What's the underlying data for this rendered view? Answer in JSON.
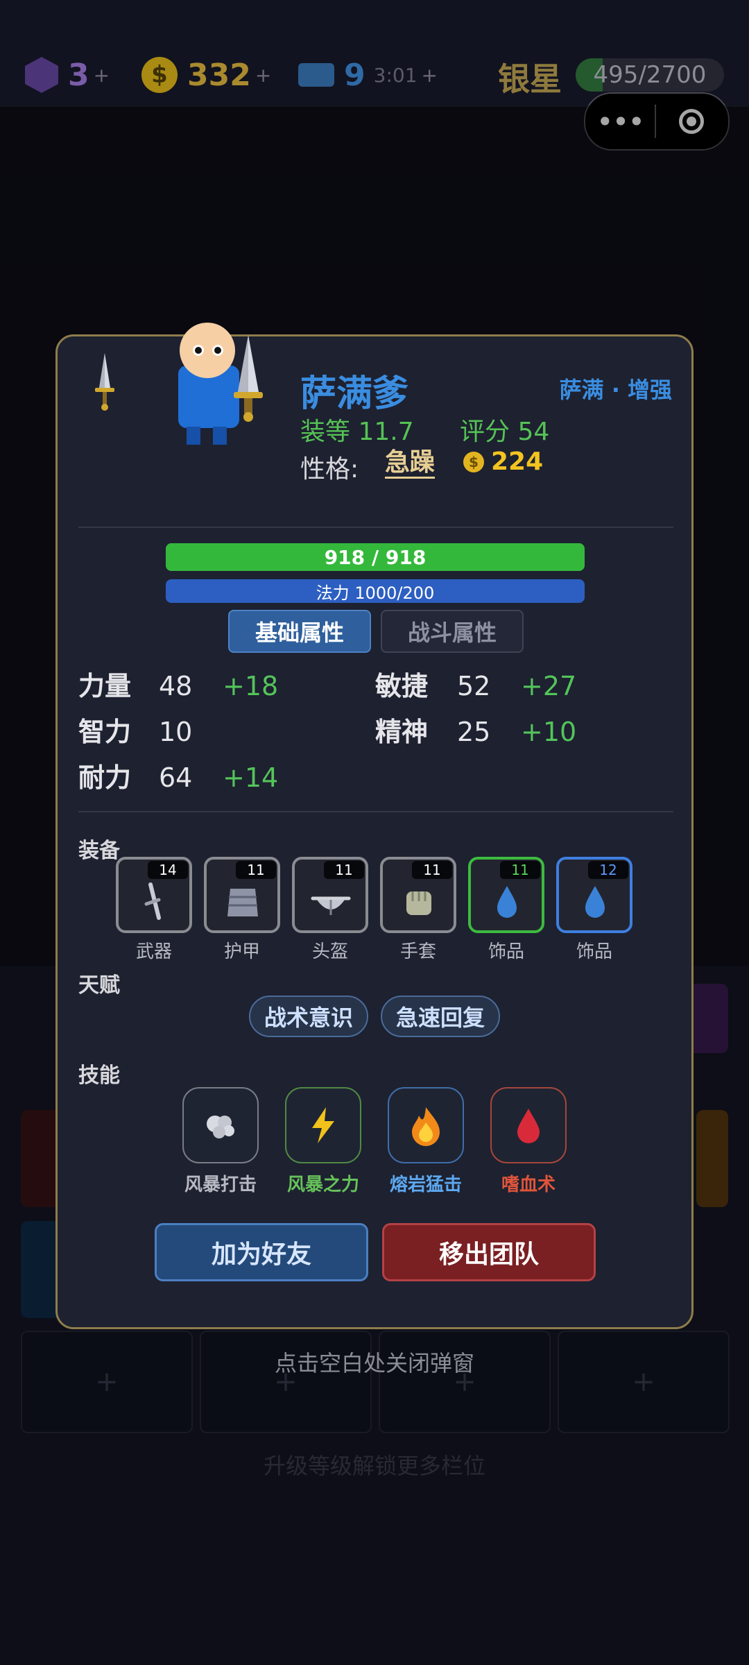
{
  "topbar": {
    "gems": "3",
    "gold": "332",
    "tickets": "9",
    "ticket_timer": "3:01",
    "plus": "+",
    "rank": "银星",
    "xp": "495/2700",
    "xp_progress": 0.183
  },
  "background": {
    "hidden_text": "升级等级解锁更多栏位",
    "slot_plus": "+"
  },
  "hero": {
    "name": "萨满爹",
    "spec": "萨满 · 增强",
    "gear_level": "装等 11.7",
    "score": "评分 54",
    "temper_label": "性格:",
    "temper": "急躁",
    "gold": "224",
    "hp_text": "918 / 918",
    "hp_progress": 1.0,
    "mp_text": "法力 1000/200",
    "mp_progress": 1.0
  },
  "tabs": {
    "basic": "基础属性",
    "combat": "战斗属性"
  },
  "stats": [
    {
      "name": "力量",
      "value": "48",
      "bonus": "+18"
    },
    {
      "name": "敏捷",
      "value": "52",
      "bonus": "+27"
    },
    {
      "name": "智力",
      "value": "10",
      "bonus": ""
    },
    {
      "name": "精神",
      "value": "25",
      "bonus": "+10"
    },
    {
      "name": "耐力",
      "value": "64",
      "bonus": "+14"
    }
  ],
  "sections": {
    "equipment": "装备",
    "talent": "天赋",
    "skills": "技能"
  },
  "equipment": [
    {
      "name": "武器",
      "level": "14",
      "icon": "sword-icon"
    },
    {
      "name": "护甲",
      "level": "11",
      "icon": "armor-icon"
    },
    {
      "name": "头盔",
      "level": "11",
      "icon": "helmet-icon"
    },
    {
      "name": "手套",
      "level": "11",
      "icon": "glove-icon"
    },
    {
      "name": "饰品",
      "level": "11",
      "icon": "water-drop-icon",
      "quality_color": "#3dbb3f"
    },
    {
      "name": "饰品",
      "level": "12",
      "icon": "water-drop-icon",
      "quality_color": "#3f7fe0"
    }
  ],
  "talents": [
    "战术意识",
    "急速回复"
  ],
  "skills": [
    {
      "name": "风暴打击",
      "icon": "cloud-icon",
      "color": "#b8b9c2"
    },
    {
      "name": "风暴之力",
      "icon": "lightning-icon",
      "color": "#66c25a"
    },
    {
      "name": "熔岩猛击",
      "icon": "fire-icon",
      "color": "#5da8f0"
    },
    {
      "name": "嗜血术",
      "icon": "blood-drop-icon",
      "color": "#e0553a"
    }
  ],
  "buttons": {
    "add_friend": "加为好友",
    "remove_team": "移出团队"
  },
  "close_hint": "点击空白处关闭弹窗"
}
